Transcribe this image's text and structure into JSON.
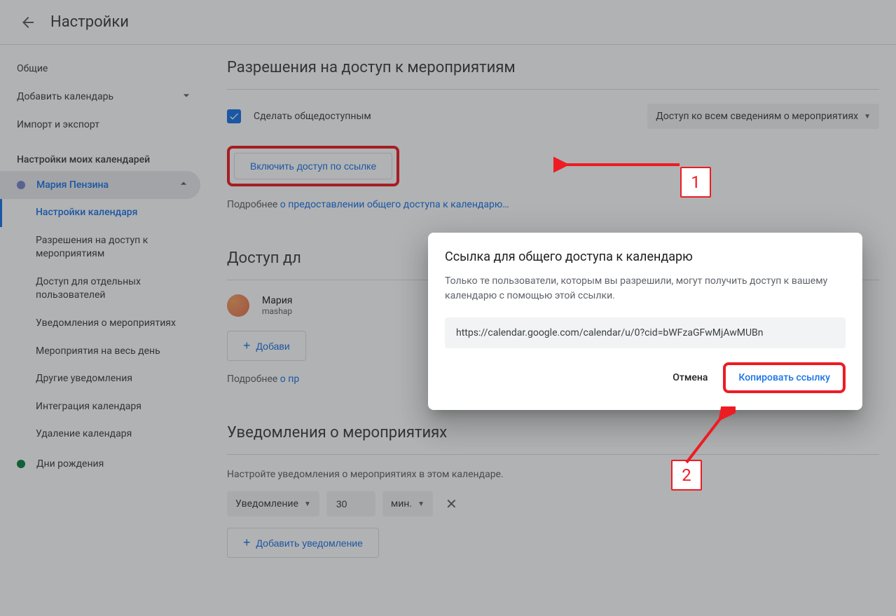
{
  "header": {
    "title": "Настройки"
  },
  "sidebar": {
    "general": "Общие",
    "add_calendar": "Добавить календарь",
    "import_export": "Импорт и экспорт",
    "my_calendars_title": "Настройки моих календарей",
    "calendar_name": "Мария Пензина",
    "calendar_color": "#7986cb",
    "sub": {
      "settings": "Настройки календаря",
      "permissions": "Разрешения на доступ к мероприятиям",
      "individual": "Доступ для отдельных пользователей",
      "notifications": "Уведомления о мероприятиях",
      "allday": "Мероприятия на весь день",
      "other_notif": "Другие уведомления",
      "integration": "Интеграция календаря",
      "delete": "Удаление календаря"
    },
    "birthdays": "Дни рождения",
    "birthdays_color": "#0b8043"
  },
  "permissions": {
    "title": "Разрешения на доступ к мероприятиям",
    "public_label": "Сделать общедоступным",
    "access_dropdown": "Доступ ко всем сведениям о мероприятиях",
    "share_button": "Включить доступ по ссылке",
    "helper_prefix": "Подробнее ",
    "helper_link": "о предоставлении общего доступа к календарю…"
  },
  "individual_access": {
    "title": "Доступ дл",
    "user_name": "Мария",
    "user_email": "mashap",
    "add_button": "Добави",
    "helper_prefix": "Подробнее ",
    "helper_link": "о пр"
  },
  "notifications": {
    "title": "Уведомления о мероприятиях",
    "subtitle": "Настройте уведомления о мероприятиях в этом календаре.",
    "type": "Уведомление",
    "value": "30",
    "unit": "мин.",
    "add_button": "Добавить уведомление"
  },
  "dialog": {
    "title": "Ссылка для общего доступа к календарю",
    "description": "Только те пользователи, которым вы разрешили, могут получить доступ к вашему календарю с помощью этой ссылки.",
    "url": "https://calendar.google.com/calendar/u/0?cid=bWFzaGFwMjAwMUBn",
    "cancel": "Отмена",
    "copy": "Копировать ссылку"
  },
  "annotations": {
    "label1": "1",
    "label2": "2"
  }
}
